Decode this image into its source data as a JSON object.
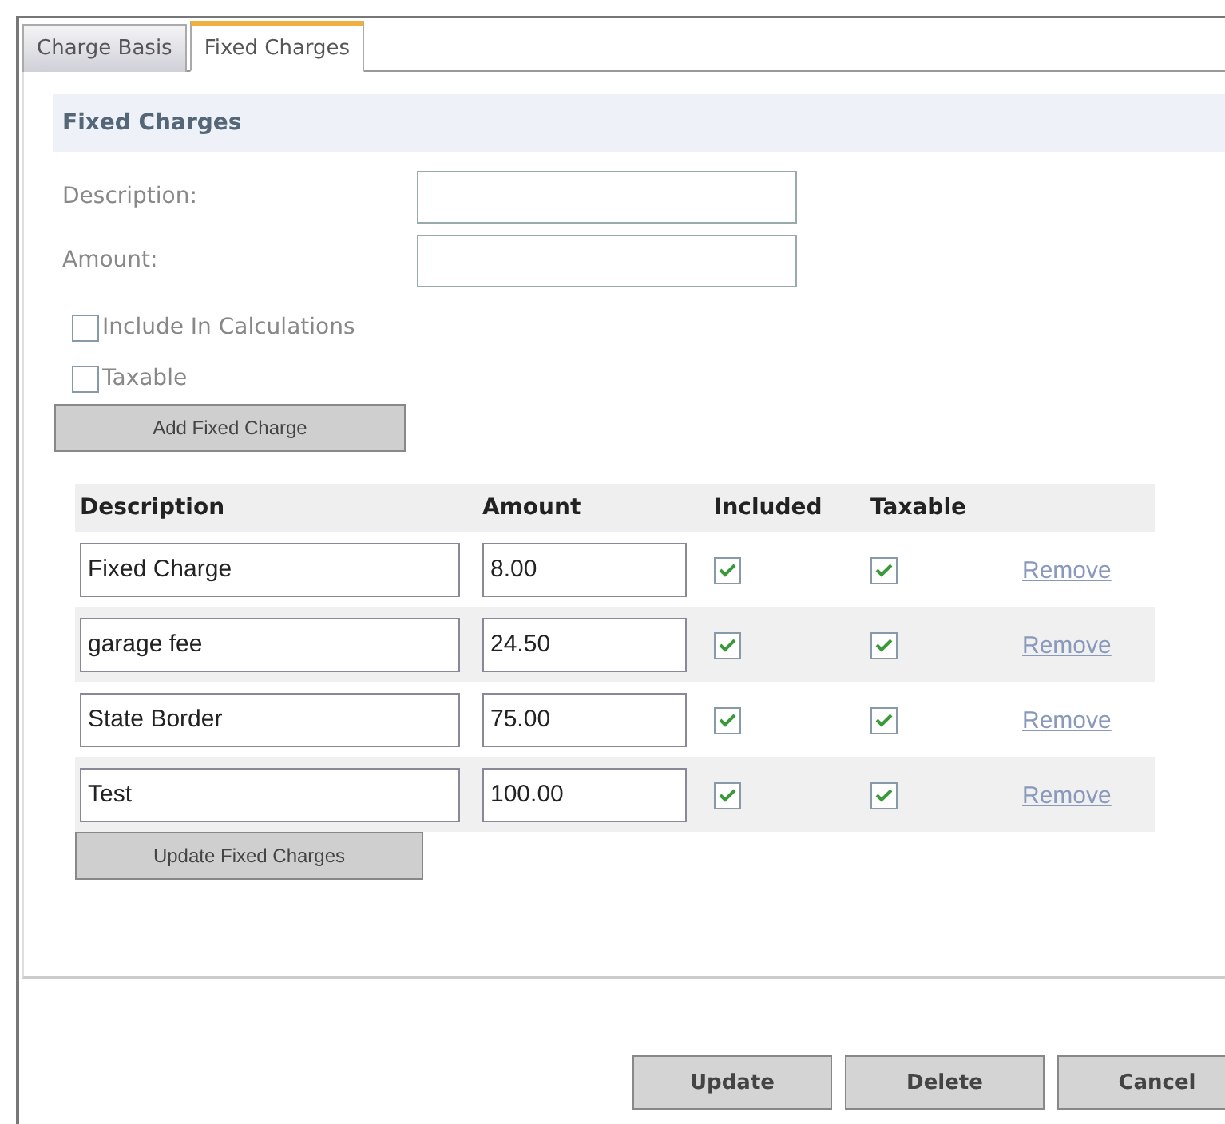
{
  "tabs": [
    {
      "label": "Charge Basis",
      "selected": false
    },
    {
      "label": "Fixed Charges",
      "selected": true
    }
  ],
  "section": {
    "title": "Fixed Charges"
  },
  "form": {
    "fields": [
      {
        "label": "Description:"
      },
      {
        "label": "Amount:"
      }
    ],
    "checkboxes": [
      {
        "label": "Include In Calculations",
        "checked": false
      },
      {
        "label": "Taxable",
        "checked": false
      }
    ],
    "add_button": "Add Fixed Charge"
  },
  "table": {
    "columns": [
      "Description",
      "Amount",
      "Included",
      "Taxable"
    ],
    "rows": [
      {
        "description": "Fixed Charge",
        "amount": "8.00",
        "included": true,
        "taxable": true,
        "action": "Remove"
      },
      {
        "description": "garage fee",
        "amount": "24.50",
        "included": true,
        "taxable": true,
        "action": "Remove"
      },
      {
        "description": "State Border",
        "amount": "75.00",
        "included": true,
        "taxable": true,
        "action": "Remove"
      },
      {
        "description": "Test",
        "amount": "100.00",
        "included": true,
        "taxable": true,
        "action": "Remove"
      }
    ],
    "update_button": "Update Fixed Charges"
  },
  "buttons": [
    "Update",
    "Delete",
    "Cancel"
  ]
}
